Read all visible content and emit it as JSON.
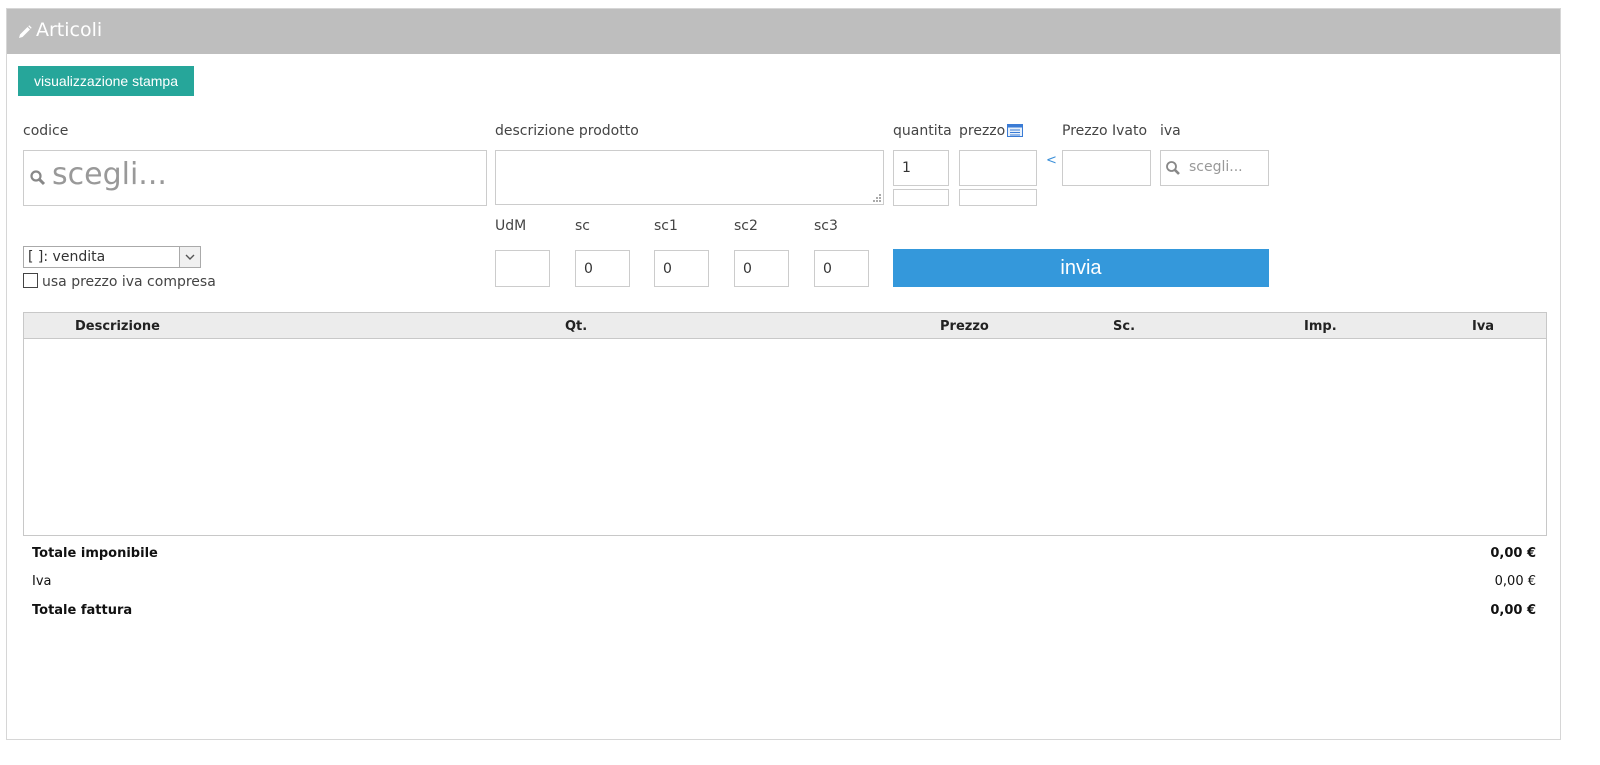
{
  "header": {
    "title": "Articoli",
    "icon": "pencil-icon"
  },
  "toolbar": {
    "print_label": "visualizzazione stampa"
  },
  "form": {
    "codice_label": "codice",
    "codice_placeholder": "scegli...",
    "descrizione_label": "descrizione prodotto",
    "descrizione_value": "",
    "quantita_label": "quantita",
    "quantita_value": "1",
    "prezzo_label": "prezzo",
    "prezzo_value": "",
    "prezzo_ivato_label": "Prezzo Ivato",
    "prezzo_ivato_value": "",
    "copy_arrow": "<",
    "iva_label": "iva",
    "iva_placeholder": "scegli...",
    "udm_label": "UdM",
    "udm_value": "",
    "sc_label": "sc",
    "sc_value": "0",
    "sc1_label": "sc1",
    "sc1_value": "0",
    "sc2_label": "sc2",
    "sc2_value": "0",
    "sc3_label": "sc3",
    "sc3_value": "0",
    "listino_selected": "[ ]: vendita",
    "usa_prezzo_label": "usa prezzo iva compresa",
    "usa_prezzo_checked": false,
    "send_label": "invia"
  },
  "table": {
    "columns": [
      "Descrizione",
      "Qt.",
      "Prezzo",
      "Sc.",
      "Imp.",
      "Iva"
    ],
    "rows": []
  },
  "totals": {
    "imponibile_label": "Totale imponibile",
    "imponibile_value": "0,00 €",
    "iva_label": "Iva",
    "iva_value": "0,00 €",
    "fattura_label": "Totale fattura",
    "fattura_value": "0,00 €"
  },
  "colors": {
    "header_bg": "#bebebe",
    "print_button": "#26a69a",
    "send_button": "#3498db"
  }
}
